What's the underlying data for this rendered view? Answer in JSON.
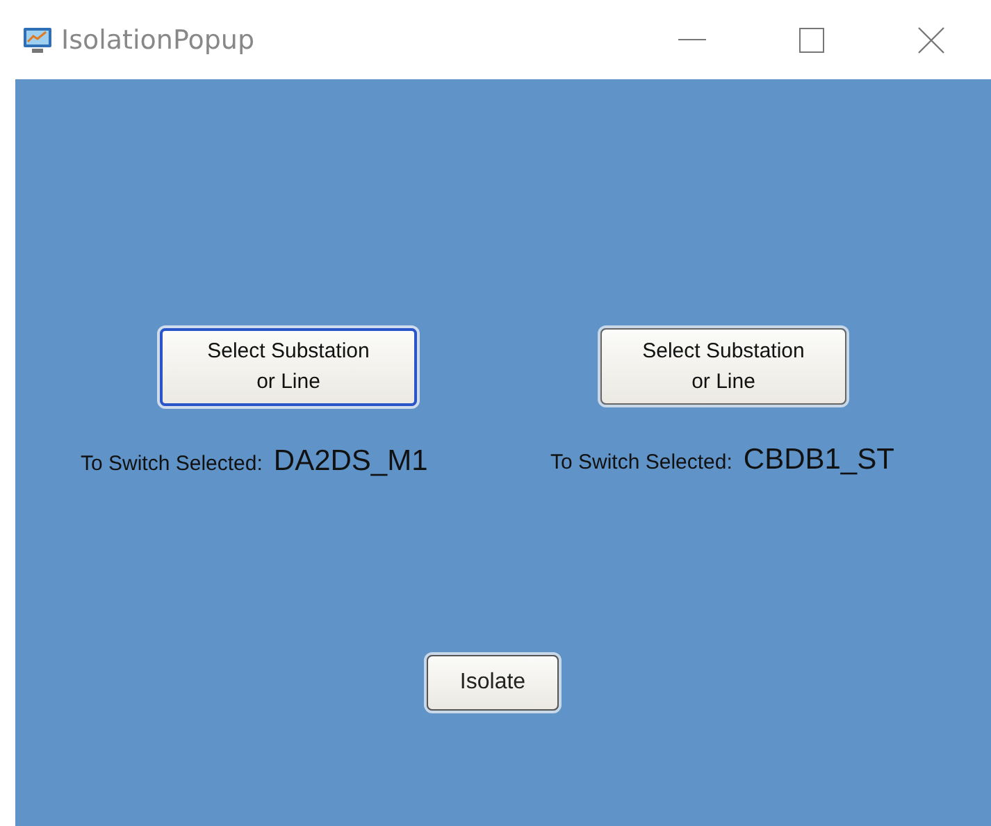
{
  "window": {
    "title": "IsolationPopup"
  },
  "selectors": [
    {
      "button": "Select Substation or Line",
      "focused": true,
      "label": "To Switch Selected:",
      "value": "DA2DS_M1"
    },
    {
      "button": "Select Substation or Line",
      "focused": false,
      "label": "To Switch Selected:",
      "value": "CBDB1_ST"
    }
  ],
  "action_button": "Isolate"
}
